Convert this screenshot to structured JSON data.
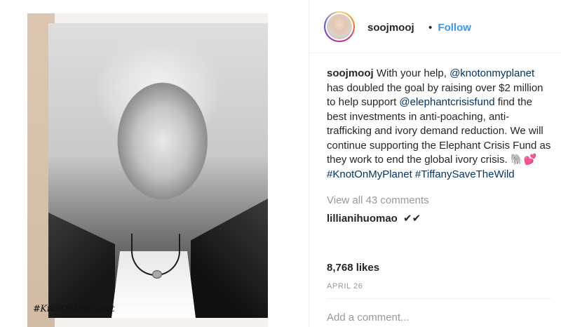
{
  "image": {
    "photo_signature": "#KnotOnMyPlanet"
  },
  "header": {
    "username": "soojmooj",
    "dot": "•",
    "follow_label": "Follow",
    "follow_color": "#3897f0"
  },
  "caption": {
    "username": "soojmooj",
    "text_1": " With your help, ",
    "mention_1": "@knotonmyplanet",
    "text_2": " has doubled the goal by raising over $2 million to help support ",
    "mention_2": "@elephantcrisisfund",
    "text_3": " find the best investments in anti-poaching, anti-trafficking and ivory demand reduction. We will continue supporting the Elephant Crisis Fund as they work to end the global ivory crisis. 🐘💕 ",
    "hashtag_1": "#KnotOnMyPlanet",
    "hashtag_2": "#TiffanySaveTheWild",
    "link_color": "#003569"
  },
  "comments": {
    "view_all_label": "View all 43 comments",
    "items": [
      {
        "username": "lillianihuomao",
        "text": "✔✔"
      }
    ]
  },
  "likes": {
    "label": "8,768 likes"
  },
  "date": {
    "label": "APRIL 26"
  },
  "add_comment": {
    "placeholder": "Add a comment..."
  }
}
